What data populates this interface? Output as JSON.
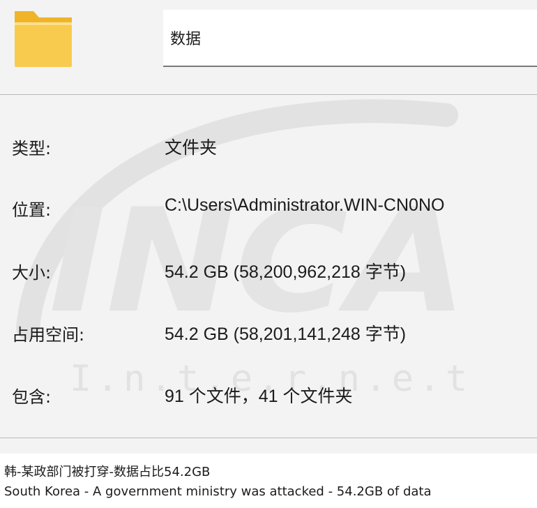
{
  "folder_icon": "folder-icon",
  "name_field": {
    "value": "数据"
  },
  "properties": [
    {
      "label": "类型:",
      "value": "文件夹"
    },
    {
      "label": "位置:",
      "value": "C:\\Users\\Administrator.WIN-CN0NO"
    },
    {
      "label": "大小:",
      "value": "54.2 GB (58,200,962,218 字节)"
    },
    {
      "label": "占用空间:",
      "value": "54.2 GB (58,201,141,248 字节)"
    },
    {
      "label": "包含:",
      "value": "91 个文件，41 个文件夹"
    }
  ],
  "watermark": {
    "logo_text": "INCA",
    "sub_text": "I.n.t.e.r.n.e.t"
  },
  "caption": {
    "chinese": "韩-某政部门被打穿-数据占比54.2GB",
    "english": "South Korea - A government ministry was attacked - 54.2GB of data"
  },
  "colors": {
    "panel_bg": "#f3f3f3",
    "folder_yellow": "#f8cb4f",
    "folder_tab": "#f0b429",
    "divider": "#b9b9b9",
    "text": "#1b1b1b"
  }
}
